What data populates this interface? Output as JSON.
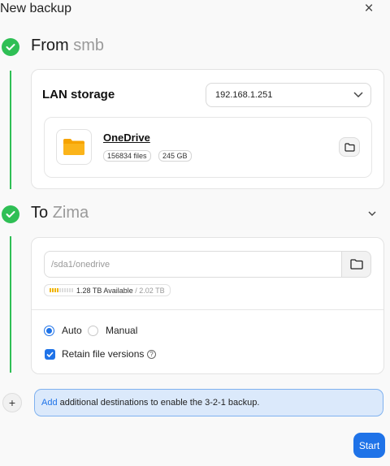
{
  "dialog": {
    "title": "New backup",
    "close_icon": "close-icon"
  },
  "from": {
    "label": "From",
    "source": "smb",
    "card_label": "LAN storage",
    "ip_value": "192.168.1.251",
    "item": {
      "name": "OneDrive",
      "files": "156834 files",
      "size": "245 GB"
    }
  },
  "to": {
    "label": "To",
    "target": "Zima",
    "path_placeholder": "/sda1/onedrive",
    "available": "1.28 TB Available",
    "total": "/ 2.02 TB",
    "usage_fraction": 0.37,
    "mode_options": [
      "Auto",
      "Manual"
    ],
    "mode_selected": "Auto",
    "retain_label": "Retain file versions",
    "retain_checked": true
  },
  "notice": {
    "link": "Add",
    "text": "additional destinations to enable the 3-2-1 backup."
  },
  "actions": {
    "start_label": "Start"
  },
  "colors": {
    "success": "#2fbf55",
    "accent": "#1f73e8",
    "folder": "#f6a300"
  }
}
